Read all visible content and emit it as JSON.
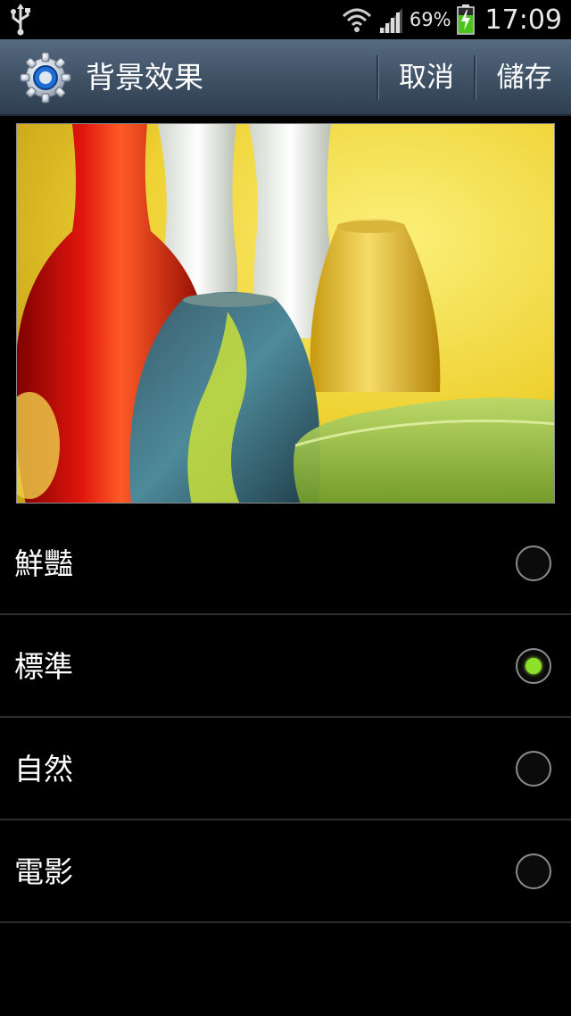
{
  "status_bar": {
    "usb_icon": "usb-icon",
    "wifi_icon": "wifi-icon",
    "signal_icon": "signal-icon",
    "battery_percent": "69%",
    "battery_level": 0.69,
    "battery_charging": true,
    "time": "17:09"
  },
  "action_bar": {
    "icon": "settings-gear-icon",
    "title": "背景效果",
    "cancel_label": "取消",
    "save_label": "儲存"
  },
  "preview": {
    "description_icon": "glass-vases-preview-image"
  },
  "options": [
    {
      "label": "鮮豔",
      "selected": false
    },
    {
      "label": "標準",
      "selected": true
    },
    {
      "label": "自然",
      "selected": false
    },
    {
      "label": "電影",
      "selected": false
    }
  ],
  "colors": {
    "accent_selected": "#8ee02a",
    "action_bar": "#3e5064"
  }
}
